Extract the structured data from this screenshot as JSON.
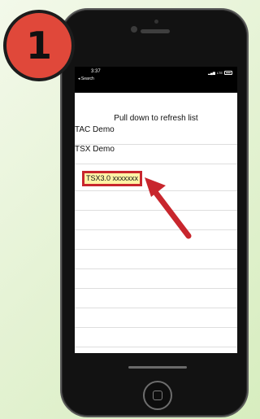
{
  "step": {
    "number": "1"
  },
  "status_bar": {
    "time": "3:37",
    "back_label": "◂ Search",
    "carrier": "LTE"
  },
  "screen": {
    "refresh_hint": "Pull down to refresh list"
  },
  "list": {
    "items": [
      {
        "label": "TAC Demo"
      },
      {
        "label": "TSX Demo"
      },
      {
        "label": "TSX3.0 xxxxxxx",
        "highlighted": true
      }
    ]
  },
  "colors": {
    "badge": "#e0483a",
    "highlight": "#fff3a6",
    "callout": "#c8262d"
  },
  "icons": {
    "arrow": "arrow-pointer-icon",
    "home": "home-button-icon"
  }
}
